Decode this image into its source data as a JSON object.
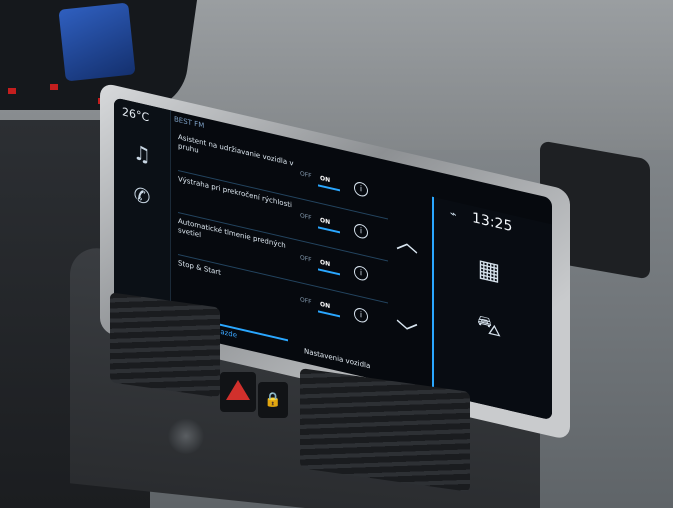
{
  "display": {
    "temperature": "26°C",
    "status_text": "BEST FM",
    "time": "13:25",
    "settings_rows": [
      {
        "label": "Asistent na udržiavanie vozidla v pruhu",
        "off": "OFF",
        "on": "ON",
        "info": "i"
      },
      {
        "label": "Výstraha pri prekročení rýchlosti",
        "off": "OFF",
        "on": "ON",
        "info": "i"
      },
      {
        "label": "Automatické tlmenie predných svetiel",
        "off": "OFF",
        "on": "ON",
        "info": "i"
      },
      {
        "label": "Stop & Start",
        "off": "OFF",
        "on": "ON",
        "info": "i"
      }
    ],
    "footer_left": "Funkcie pri jazde",
    "footer_right": "Nastavenia vozidla"
  },
  "colors": {
    "accent": "#2aa7ff",
    "screen_bg": "#06090e",
    "hazard": "#d1302c"
  },
  "icons": {
    "music": "music-note-icon",
    "phone": "phone-icon",
    "grid": "apps-grid-icon",
    "car": "car-icon",
    "up": "chevron-up-icon",
    "down": "chevron-down-icon"
  }
}
